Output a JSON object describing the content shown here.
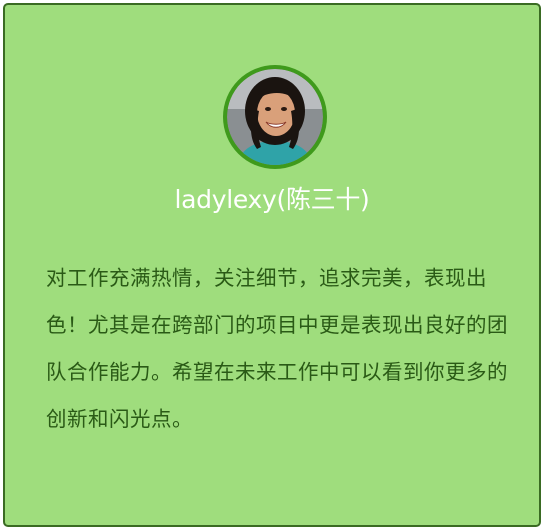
{
  "profile": {
    "avatar_icon": "person-photo-avatar",
    "username": "ladylexy(陈三十)",
    "quote": "对工作充满热情，关注细节，追求完美，表现出色！尤其是在跨部门的项目中更是表现出良好的团队合作能力。希望在未来工作中可以看到你更多的创新和闪光点。"
  },
  "colors": {
    "card_background": "#9fdd7d",
    "card_border": "#3a6b23",
    "avatar_ring": "#3f9a1c",
    "username_text": "#ffffff",
    "quote_text": "#2a5a16"
  }
}
